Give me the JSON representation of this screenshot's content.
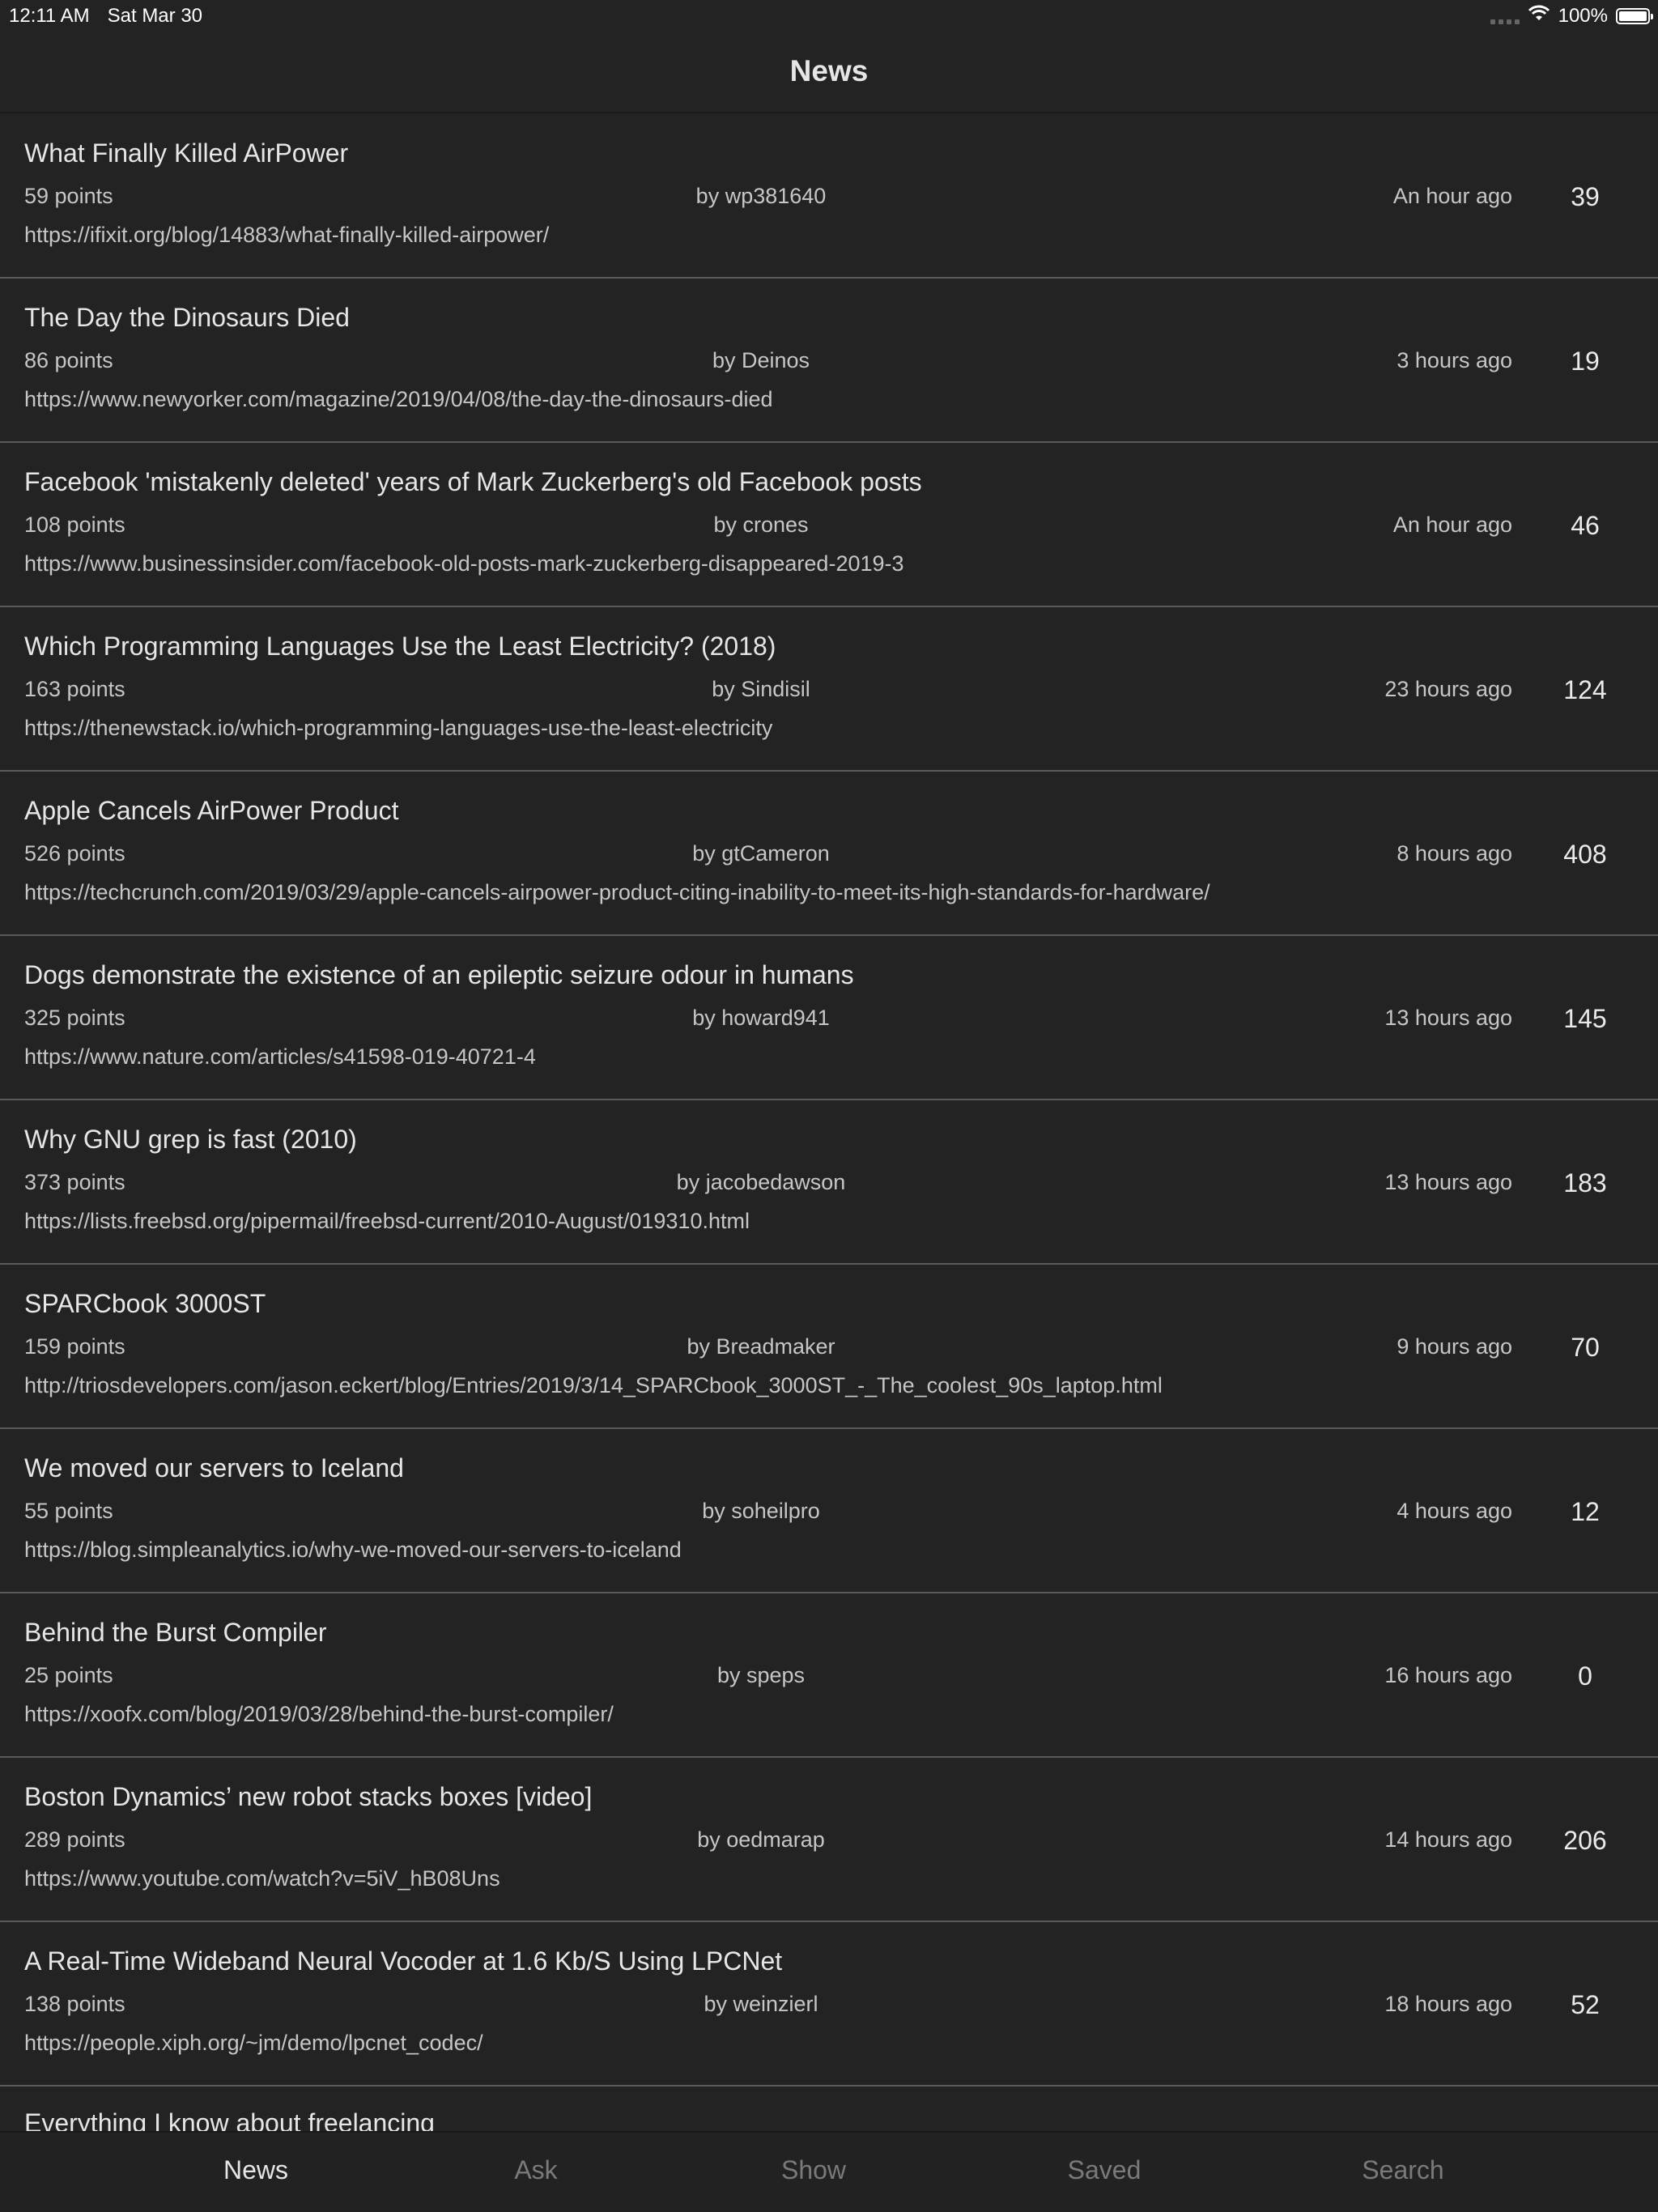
{
  "status_bar": {
    "time": "12:11 AM",
    "date": "Sat Mar 30",
    "battery": "100%",
    "icons": [
      "signal-dots-icon",
      "wifi-icon",
      "battery-icon"
    ]
  },
  "nav": {
    "title": "News"
  },
  "stories": [
    {
      "title": "What Finally Killed AirPower",
      "points": "59 points",
      "author": "by wp381640",
      "time": "An hour ago",
      "url": "https://ifixit.org/blog/14883/what-finally-killed-airpower/",
      "comments": "39"
    },
    {
      "title": "The Day the Dinosaurs Died",
      "points": "86 points",
      "author": "by Deinos",
      "time": "3 hours ago",
      "url": "https://www.newyorker.com/magazine/2019/04/08/the-day-the-dinosaurs-died",
      "comments": "19"
    },
    {
      "title": "Facebook 'mistakenly deleted' years of Mark Zuckerberg's old Facebook posts",
      "points": "108 points",
      "author": "by crones",
      "time": "An hour ago",
      "url": "https://www.businessinsider.com/facebook-old-posts-mark-zuckerberg-disappeared-2019-3",
      "comments": "46"
    },
    {
      "title": "Which Programming Languages Use the Least Electricity? (2018)",
      "points": "163 points",
      "author": "by Sindisil",
      "time": "23 hours ago",
      "url": "https://thenewstack.io/which-programming-languages-use-the-least-electricity",
      "comments": "124"
    },
    {
      "title": "Apple Cancels AirPower Product",
      "points": "526 points",
      "author": "by gtCameron",
      "time": "8 hours ago",
      "url": "https://techcrunch.com/2019/03/29/apple-cancels-airpower-product-citing-inability-to-meet-its-high-standards-for-hardware/",
      "comments": "408"
    },
    {
      "title": "Dogs demonstrate the existence of an epileptic seizure odour in humans",
      "points": "325 points",
      "author": "by howard941",
      "time": "13 hours ago",
      "url": "https://www.nature.com/articles/s41598-019-40721-4",
      "comments": "145"
    },
    {
      "title": "Why GNU grep is fast (2010)",
      "points": "373 points",
      "author": "by jacobedawson",
      "time": "13 hours ago",
      "url": "https://lists.freebsd.org/pipermail/freebsd-current/2010-August/019310.html",
      "comments": "183"
    },
    {
      "title": "SPARCbook 3000ST",
      "points": "159 points",
      "author": "by Breadmaker",
      "time": "9 hours ago",
      "url": "http://triosdevelopers.com/jason.eckert/blog/Entries/2019/3/14_SPARCbook_3000ST_-_The_coolest_90s_laptop.html",
      "comments": "70"
    },
    {
      "title": "We moved our servers to Iceland",
      "points": "55 points",
      "author": "by soheilpro",
      "time": "4 hours ago",
      "url": "https://blog.simpleanalytics.io/why-we-moved-our-servers-to-iceland",
      "comments": "12"
    },
    {
      "title": "Behind the Burst Compiler",
      "points": "25 points",
      "author": "by speps",
      "time": "16 hours ago",
      "url": "https://xoofx.com/blog/2019/03/28/behind-the-burst-compiler/",
      "comments": "0"
    },
    {
      "title": "Boston Dynamics’ new robot stacks boxes [video]",
      "points": "289 points",
      "author": "by oedmarap",
      "time": "14 hours ago",
      "url": "https://www.youtube.com/watch?v=5iV_hB08Uns",
      "comments": "206"
    },
    {
      "title": "A Real-Time Wideband Neural Vocoder at 1.6 Kb/S Using LPCNet",
      "points": "138 points",
      "author": "by weinzierl",
      "time": "18 hours ago",
      "url": "https://people.xiph.org/~jm/demo/lpcnet_codec/",
      "comments": "52"
    }
  ],
  "partial_story": {
    "title": "Everything I know about freelancing"
  },
  "tabs": [
    {
      "label": "News",
      "active": true
    },
    {
      "label": "Ask",
      "active": false
    },
    {
      "label": "Show",
      "active": false
    },
    {
      "label": "Saved",
      "active": false
    },
    {
      "label": "Search",
      "active": false
    }
  ]
}
